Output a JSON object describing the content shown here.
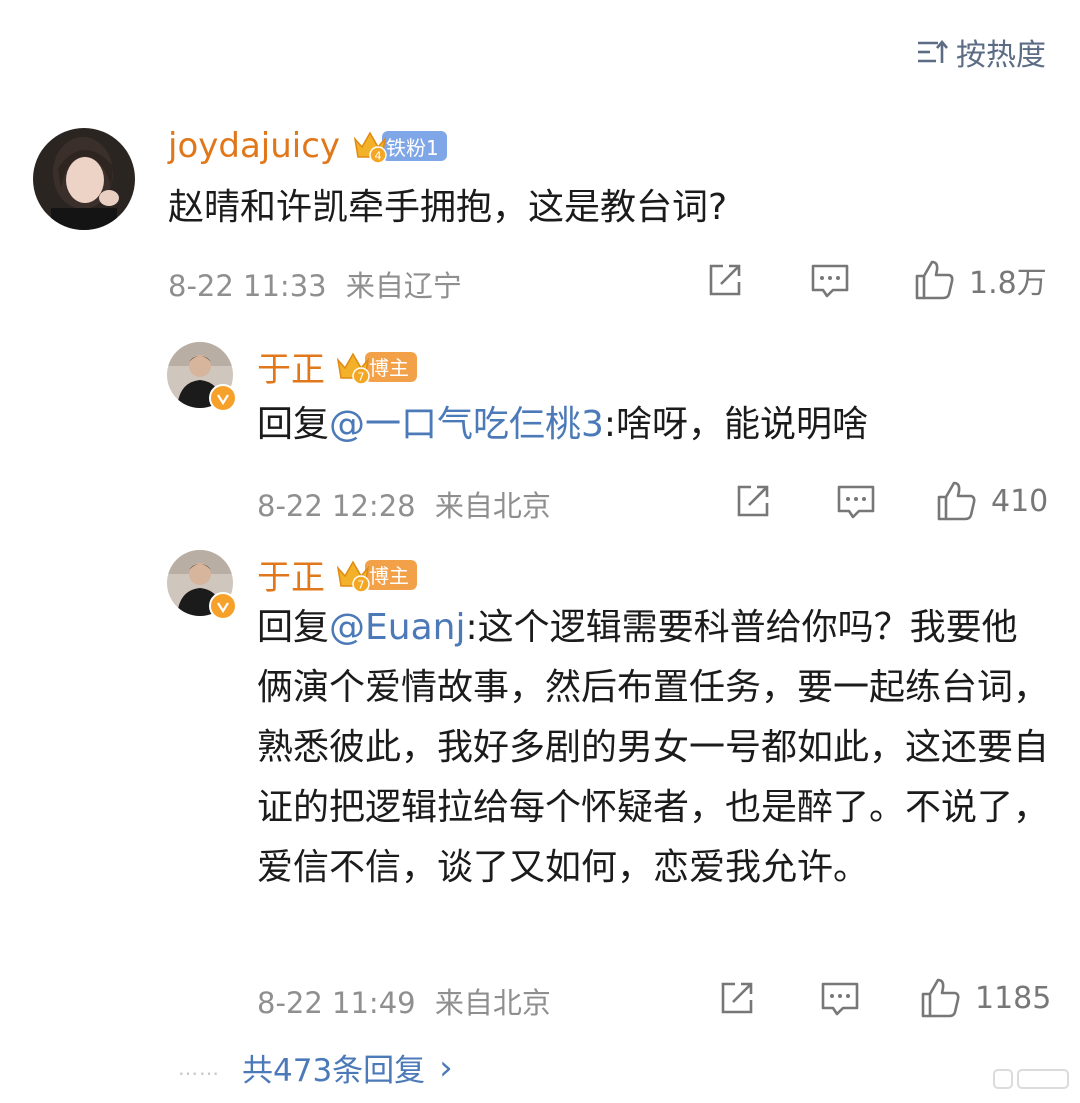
{
  "sort": {
    "icon": "sort-icon",
    "label": "按热度"
  },
  "main_comment": {
    "username": "joydajuicy",
    "badge": {
      "level": "4",
      "label": "铁粉1",
      "color": "#7fa6e6"
    },
    "text": "赵晴和许凯牵手拥抱，这是教台词?",
    "time": "8-22 11:33",
    "location": "来自辽宁",
    "likes": "1.8万"
  },
  "replies": [
    {
      "username": "于正",
      "badge": {
        "level": "7",
        "label": "博主",
        "color": "#f3a148"
      },
      "reply_prefix": "回复",
      "mention": "@一口气吃仨桃3",
      "text": ":啥呀，能说明啥",
      "time": "8-22 12:28",
      "location": "来自北京",
      "likes": "410"
    },
    {
      "username": "于正",
      "badge": {
        "level": "7",
        "label": "博主",
        "color": "#f3a148"
      },
      "reply_prefix": "回复",
      "mention": "@Euanj",
      "text": ":这个逻辑需要科普给你吗？我要他俩演个爱情故事，然后布置任务，要一起练台词，熟悉彼此，我好多剧的男女一号都如此，这还要自证的把逻辑拉给每个怀疑者，也是醉了。不说了，爱信不信，谈了又如何，恋爱我允许。",
      "time": "8-22 11:49",
      "location": "来自北京",
      "likes": "1185"
    }
  ],
  "more_replies": {
    "dots": "……",
    "label": "共473条回复",
    "chevron": "›"
  },
  "colors": {
    "username": "#e0771b",
    "link": "#4c79b8",
    "meta": "#8f8f8f"
  }
}
